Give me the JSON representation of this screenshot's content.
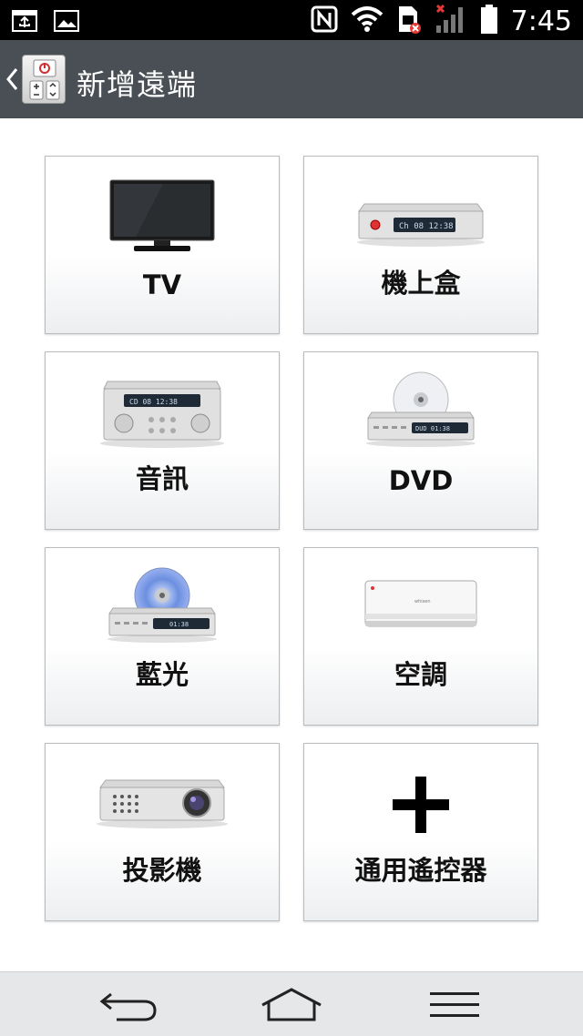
{
  "status_bar": {
    "time": "7:45",
    "left_icons": [
      "usb-icon",
      "image-icon"
    ],
    "right_icons": [
      "nfc-icon",
      "wifi-icon",
      "sim-error-icon",
      "signal-icon",
      "battery-icon"
    ]
  },
  "action_bar": {
    "title": "新增遠端"
  },
  "tiles": [
    {
      "label": "TV",
      "icon": "tv-icon"
    },
    {
      "label": "機上盒",
      "icon": "set-top-box-icon"
    },
    {
      "label": "音訊",
      "icon": "audio-system-icon"
    },
    {
      "label": "DVD",
      "icon": "dvd-player-icon"
    },
    {
      "label": "藍光",
      "icon": "bluray-player-icon"
    },
    {
      "label": "空調",
      "icon": "air-conditioner-icon"
    },
    {
      "label": "投影機",
      "icon": "projector-icon"
    },
    {
      "label": "通用遙控器",
      "icon": "plus-icon"
    }
  ],
  "nav_bar": {
    "buttons": [
      "back-icon",
      "home-icon",
      "menu-icon"
    ]
  },
  "colors": {
    "status_bar_bg": "#000000",
    "action_bar_bg": "#4a4f55",
    "tile_border": "#b9bcbf",
    "nav_bar_bg": "#e6e7e8"
  }
}
